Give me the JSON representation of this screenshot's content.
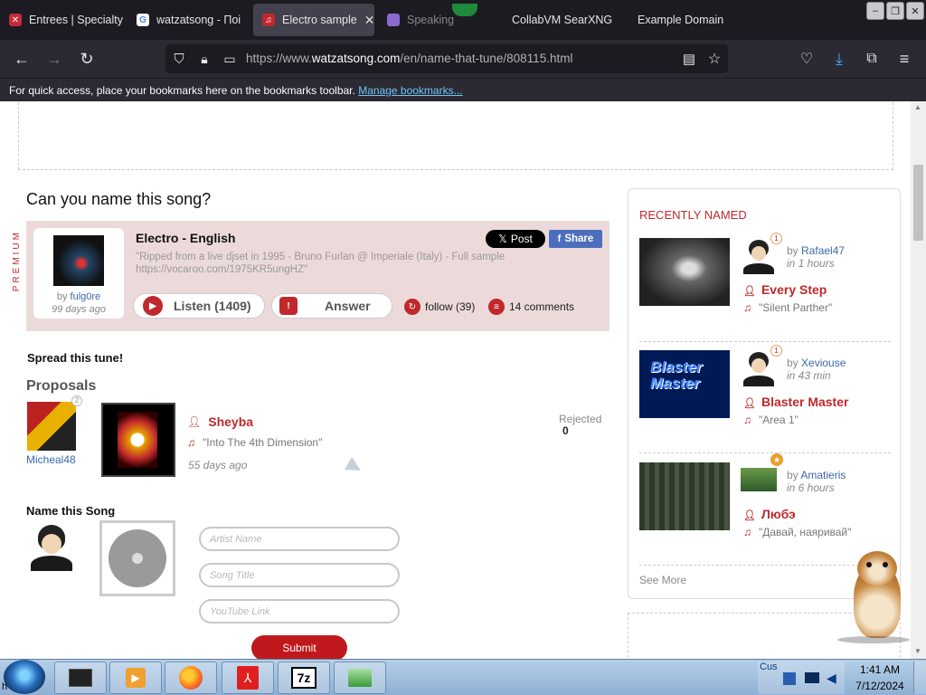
{
  "browser": {
    "tabs": [
      {
        "title": "Entrees | Specialty",
        "active": false
      },
      {
        "title": "watzatsong - Поі",
        "active": false
      },
      {
        "title": "Electro sample",
        "active": true
      },
      {
        "title": "Speaking",
        "active": false
      },
      {
        "title": "CollabVM SearXNG",
        "active": false
      },
      {
        "title": "Example Domain",
        "active": false
      }
    ],
    "url_prefix": "https://www.",
    "url_domain": "watzatsong.com",
    "url_path": "/en/name-that-tune/808115.html",
    "bookmarks_notice": "For quick access, place your bookmarks here on the bookmarks toolbar.",
    "bookmarks_link": "Manage bookmarks..."
  },
  "question": "Can you name this song?",
  "premium_label": "PREMIUM",
  "tune": {
    "user": "fulg0re",
    "by_prefix": "by",
    "age": "99 days ago",
    "title": "Electro - English",
    "description": "\"Ripped from a live djset in 1995 - Bruno Furlan @ Imperiale (Italy) - Full sample https://vocaroo.com/1975KR5ungHZ\"",
    "listen_label": "Listen (1409)",
    "answer_label": "Answer",
    "follow_label": "follow (39)",
    "comments_label": "14 comments",
    "post_label": "Post",
    "share_label": "Share"
  },
  "spread_label": "Spread this tune!",
  "proposals": {
    "heading": "Proposals",
    "items": [
      {
        "user": "Micheal48",
        "badge": "2",
        "artist": "Sheyba",
        "song": "\"Into The 4th Dimension\"",
        "age": "55 days ago",
        "status": "Rejected",
        "votes": "0"
      }
    ]
  },
  "name_song": {
    "heading": "Name this Song",
    "artist_placeholder": "Artist Name",
    "title_placeholder": "Song Title",
    "youtube_placeholder": "YouTube Link",
    "submit_label": "Submit"
  },
  "recently_named": {
    "heading": "RECENTLY NAMED",
    "items": [
      {
        "user": "Rafael47",
        "badge": "1",
        "time": "in 1 hours",
        "artist": "Every Step",
        "song": "\"Silent Parther\""
      },
      {
        "user": "Xeviouse",
        "badge": "1",
        "time": "in 43 min",
        "artist": "Blaster Master",
        "song": "\"Area 1\"",
        "thumb_text": "Blaster Master"
      },
      {
        "user": "Amatieris",
        "badge": "",
        "time": "in 6 hours",
        "artist": "Любэ",
        "song": "\"Давай, наяривай\""
      }
    ],
    "see_more": "See More"
  },
  "taskbar": {
    "tray_text": "Cus",
    "time": "1:41 AM",
    "date": "7/12/2024",
    "start_label": "h"
  },
  "colors": {
    "accent": "#c0282c",
    "link": "#3a6aa8",
    "tab_bg": "#1c1b22",
    "toolbar_bg": "#2b2a33"
  }
}
